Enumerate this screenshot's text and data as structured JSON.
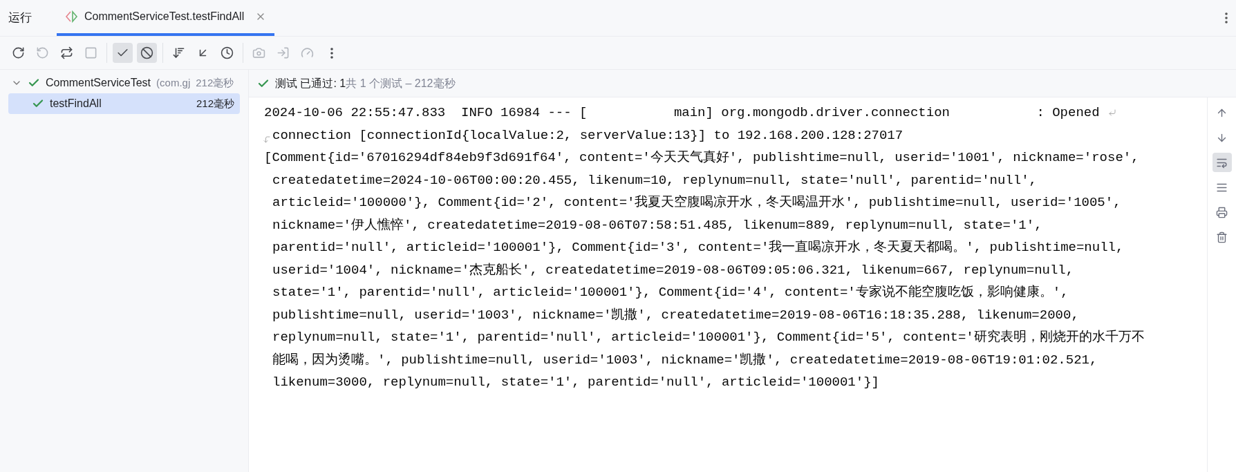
{
  "header": {
    "title": "运行",
    "tabs": [
      {
        "label": "CommentServiceTest.testFindAll",
        "selected": true
      }
    ]
  },
  "toolbar": [
    [
      {
        "kind": "rerun",
        "disabled": false,
        "on": false
      },
      {
        "kind": "rerun_failed",
        "disabled": true,
        "on": false
      },
      {
        "kind": "rerun_auto",
        "disabled": false,
        "on": false
      },
      {
        "kind": "stop",
        "disabled": true,
        "on": false
      }
    ],
    [
      {
        "kind": "show_passed",
        "disabled": false,
        "on": true
      },
      {
        "kind": "show_ignored",
        "disabled": false,
        "on": true
      }
    ],
    [
      {
        "kind": "sort",
        "disabled": false,
        "on": false
      },
      {
        "kind": "collapse",
        "disabled": false,
        "on": false
      },
      {
        "kind": "history",
        "disabled": false,
        "on": false
      }
    ],
    [
      {
        "kind": "screenshot",
        "disabled": true,
        "on": false
      },
      {
        "kind": "import",
        "disabled": true,
        "on": false
      },
      {
        "kind": "profile",
        "disabled": true,
        "on": false
      },
      {
        "kind": "more",
        "disabled": false,
        "on": false
      }
    ]
  ],
  "tree": [
    {
      "name": "CommentServiceTest",
      "package": "(com.gj",
      "time": "212毫秒",
      "passed": true,
      "expanded": true,
      "selected": false,
      "children": [
        {
          "name": "testFindAll",
          "time": "212毫秒",
          "passed": true,
          "selected": true
        }
      ]
    }
  ],
  "status": {
    "passed": true,
    "label": "测试 已通过: 1",
    "summary": "共 1 个测试 – 212毫秒"
  },
  "console": {
    "lines": [
      {
        "kind": "soft_wrap_start",
        "text": "2024-10-06 22:55:47.833  INFO 16984 --- [           main] org.mongodb.driver.connection           : Opened"
      },
      {
        "kind": "soft_wrap_end",
        "text": "connection [connectionId{localValue:2, serverValue:13}] to 192.168.200.128:27017"
      },
      {
        "kind": "first",
        "text": "[Comment{id='67016294df84eb9f3d691f64', content='今天天气真好', publishtime=null, userid='1001', nickname='rose',"
      },
      {
        "kind": "continued",
        "text": "createdatetime=2024-10-06T00:00:20.455, likenum=10, replynum=null, state='null', parentid='null',"
      },
      {
        "kind": "continued",
        "text": "articleid='100000'}, Comment{id='2', content='我夏天空腹喝凉开水，冬天喝温开水', publishtime=null, userid='1005',"
      },
      {
        "kind": "continued",
        "text": "nickname='伊人憔悴', createdatetime=2019-08-06T07:58:51.485, likenum=889, replynum=null, state='1',"
      },
      {
        "kind": "continued",
        "text": "parentid='null', articleid='100001'}, Comment{id='3', content='我一直喝凉开水，冬天夏天都喝。', publishtime=null,"
      },
      {
        "kind": "continued",
        "text": "userid='1004', nickname='杰克船长', createdatetime=2019-08-06T09:05:06.321, likenum=667, replynum=null,"
      },
      {
        "kind": "continued",
        "text": "state='1', parentid='null', articleid='100001'}, Comment{id='4', content='专家说不能空腹吃饭，影响健康。',"
      },
      {
        "kind": "continued",
        "text": "publishtime=null, userid='1003', nickname='凯撒', createdatetime=2019-08-06T16:18:35.288, likenum=2000,"
      },
      {
        "kind": "continued",
        "text": "replynum=null, state='1', parentid='null', articleid='100001'}, Comment{id='5', content='研究表明，刚烧开的水千万不"
      },
      {
        "kind": "continued",
        "text": "能喝，因为烫嘴。', publishtime=null, userid='1003', nickname='凯撒', createdatetime=2019-08-06T19:01:02.521,"
      },
      {
        "kind": "continued",
        "text": "likenum=3000, replynum=null, state='1', parentid='null', articleid='100001'}]"
      }
    ]
  },
  "side_tools": [
    {
      "kind": "up",
      "on": false
    },
    {
      "kind": "down",
      "on": false
    },
    {
      "kind": "wrap",
      "on": true
    },
    {
      "kind": "scroll_end",
      "on": false
    },
    {
      "kind": "print",
      "on": false
    },
    {
      "kind": "clear",
      "on": false
    }
  ]
}
